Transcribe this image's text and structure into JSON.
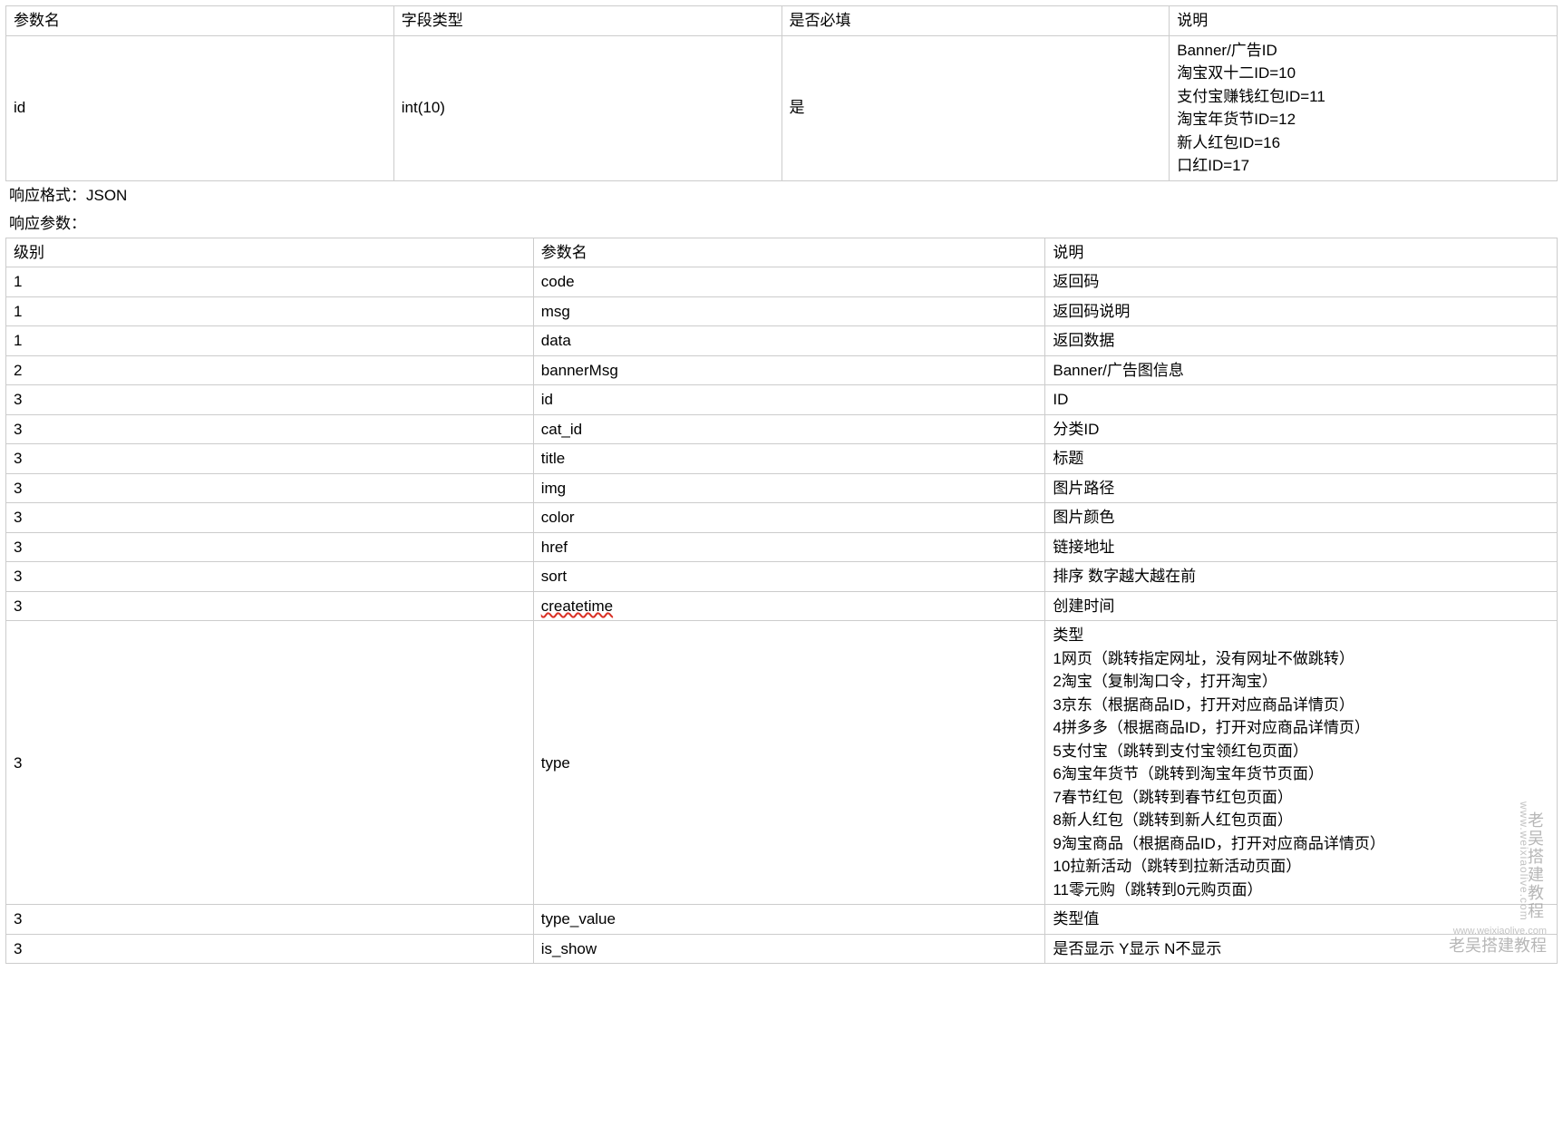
{
  "request_table": {
    "headers": [
      "参数名",
      "字段类型",
      "是否必填",
      "说明"
    ],
    "rows": [
      {
        "param": "id",
        "type": "int(10)",
        "required": "是",
        "desc": "Banner/广告ID\n淘宝双十二ID=10\n支付宝赚钱红包ID=11\n淘宝年货节ID=12\n新人红包ID=16\n口红ID=17"
      }
    ]
  },
  "response_format_label": "响应格式：JSON",
  "response_params_label": "响应参数：",
  "response_table": {
    "headers": [
      "级别",
      "参数名",
      "说明"
    ],
    "rows": [
      {
        "level": "1",
        "param": "code",
        "desc": "返回码"
      },
      {
        "level": "1",
        "param": "msg",
        "desc": "返回码说明"
      },
      {
        "level": "1",
        "param": "data",
        "desc": "返回数据"
      },
      {
        "level": "2",
        "param": "bannerMsg",
        "desc": "Banner/广告图信息"
      },
      {
        "level": "3",
        "param": "id",
        "desc": "ID"
      },
      {
        "level": "3",
        "param": "cat_id",
        "desc": "分类ID"
      },
      {
        "level": "3",
        "param": "title",
        "desc": "标题"
      },
      {
        "level": "3",
        "param": "img",
        "desc": "图片路径"
      },
      {
        "level": "3",
        "param": "color",
        "desc": "图片颜色"
      },
      {
        "level": "3",
        "param": "href",
        "desc": "链接地址"
      },
      {
        "level": "3",
        "param": "sort",
        "desc": "排序 数字越大越在前"
      },
      {
        "level": "3",
        "param": "createtime",
        "desc": "创建时间",
        "spellcheck": true
      },
      {
        "level": "3",
        "param": "type",
        "desc": "类型\n1网页（跳转指定网址，没有网址不做跳转）\n2淘宝（复制淘口令，打开淘宝）\n3京东（根据商品ID，打开对应商品详情页）\n4拼多多（根据商品ID，打开对应商品详情页）\n5支付宝（跳转到支付宝领红包页面）\n6淘宝年货节（跳转到淘宝年货节页面）\n7春节红包（跳转到春节红包页面）\n8新人红包（跳转到新人红包页面）\n9淘宝商品（根据商品ID，打开对应商品详情页）\n10拉新活动（跳转到拉新活动页面）\n11零元购（跳转到0元购页面）"
      },
      {
        "level": "3",
        "param": "type_value",
        "desc": "类型值"
      },
      {
        "level": "3",
        "param": "is_show",
        "desc": "是否显示 Y显示 N不显示"
      }
    ]
  },
  "watermark_cn": "老吴搭建教程",
  "watermark_en": "www.weixiaolive.com",
  "watermark_footer_cn": "老吴搭建教程",
  "watermark_footer_en": "www.weixiaolive.com"
}
